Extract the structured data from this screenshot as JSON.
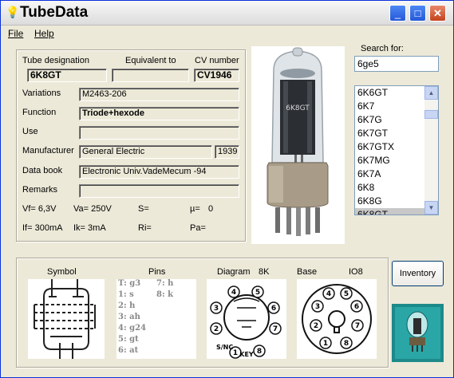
{
  "window": {
    "title": "TubeData"
  },
  "titlebar": {
    "minimize": "_",
    "maximize": "□",
    "close": "✕"
  },
  "menu": {
    "file": "File",
    "help": "Help"
  },
  "labels": {
    "tube_designation": "Tube designation",
    "equivalent_to": "Equivalent to",
    "cv_number": "CV number",
    "variations": "Variations",
    "function": "Function",
    "use": "Use",
    "manufacturer": "Manufacturer",
    "data_book": "Data book",
    "remarks": "Remarks",
    "search_for": "Search for:",
    "symbol": "Symbol",
    "pins": "Pins",
    "diagram": "Diagram",
    "base": "Base"
  },
  "fields": {
    "tube_designation": "6K8GT",
    "equivalent_to": "",
    "cv_number": "CV1946",
    "variations": "M2463-206",
    "function": "Triode+hexode",
    "use": "",
    "manufacturer": "General Electric",
    "year": "1939",
    "data_book": "Electronic Univ.VadeMecum -94",
    "remarks": ""
  },
  "params": {
    "vf": "Vf= 6,3V",
    "va": "Va= 250V",
    "s": "S=",
    "mu": "µ=",
    "mu_val": "0",
    "if": "If= 300mA",
    "ik": "Ik= 3mA",
    "ri": "Ri=",
    "pa": "Pa="
  },
  "search": {
    "value": "6ge5"
  },
  "tube_list": {
    "items": [
      "6K6GT",
      "6K7",
      "6K7G",
      "6K7GT",
      "6K7GTX",
      "6K7MG",
      "6K7A",
      "6K8",
      "6K8G",
      "6K8GT"
    ],
    "selected": "6K8GT"
  },
  "photo": {
    "tube_print": "6K8GT"
  },
  "pins_list": [
    "T: g3",
    "1: s",
    "2: h",
    "3: ah",
    "4: g24",
    "5: gt",
    "6: at",
    "7: h",
    "8: k"
  ],
  "diagram": {
    "code": "8K",
    "pin_numbers": [
      "1",
      "2",
      "3",
      "4",
      "5",
      "6",
      "7",
      "8"
    ],
    "key_label": "KEY",
    "snc_label": "S/NC"
  },
  "base": {
    "code": "IO8",
    "pin_numbers": [
      "1",
      "2",
      "3",
      "4",
      "5",
      "6",
      "7",
      "8"
    ]
  },
  "buttons": {
    "inventory": "Inventory"
  },
  "colors": {
    "titlebar_text": "#000000",
    "accent": "#0831d9",
    "close": "#c4421e"
  }
}
